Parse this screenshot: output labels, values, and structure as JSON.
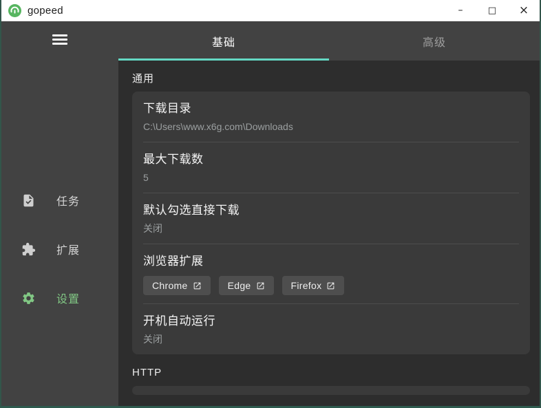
{
  "titlebar": {
    "app_title": "gopeed",
    "minimize_glyph": "–",
    "maximize_glyph": "□",
    "close_glyph": "×"
  },
  "sidebar": {
    "items": [
      {
        "label": "任务",
        "icon": "task-file-icon",
        "active": false
      },
      {
        "label": "扩展",
        "icon": "puzzle-icon",
        "active": false
      },
      {
        "label": "设置",
        "icon": "gear-icon",
        "active": true
      }
    ]
  },
  "tabs": [
    {
      "label": "基础",
      "active": true
    },
    {
      "label": "高级",
      "active": false
    }
  ],
  "content": {
    "sections": [
      {
        "header": "通用"
      },
      {
        "header": "HTTP"
      }
    ],
    "general_rows": [
      {
        "title": "下载目录",
        "value": "C:\\Users\\www.x6g.com\\Downloads"
      },
      {
        "title": "最大下载数",
        "value": "5"
      },
      {
        "title": "默认勾选直接下载",
        "value": "关闭"
      },
      {
        "title": "浏览器扩展",
        "buttons": [
          "Chrome",
          "Edge",
          "Firefox"
        ]
      },
      {
        "title": "开机自动运行",
        "value": "关闭"
      }
    ]
  },
  "colors": {
    "accent_teal": "#64d9c4",
    "accent_green": "#81c784",
    "logo_green": "#57b560",
    "window_border": "#33564b",
    "sidebar_bg": "#424242",
    "content_bg": "#2d2d2d",
    "card_bg": "#3a3a3a"
  }
}
